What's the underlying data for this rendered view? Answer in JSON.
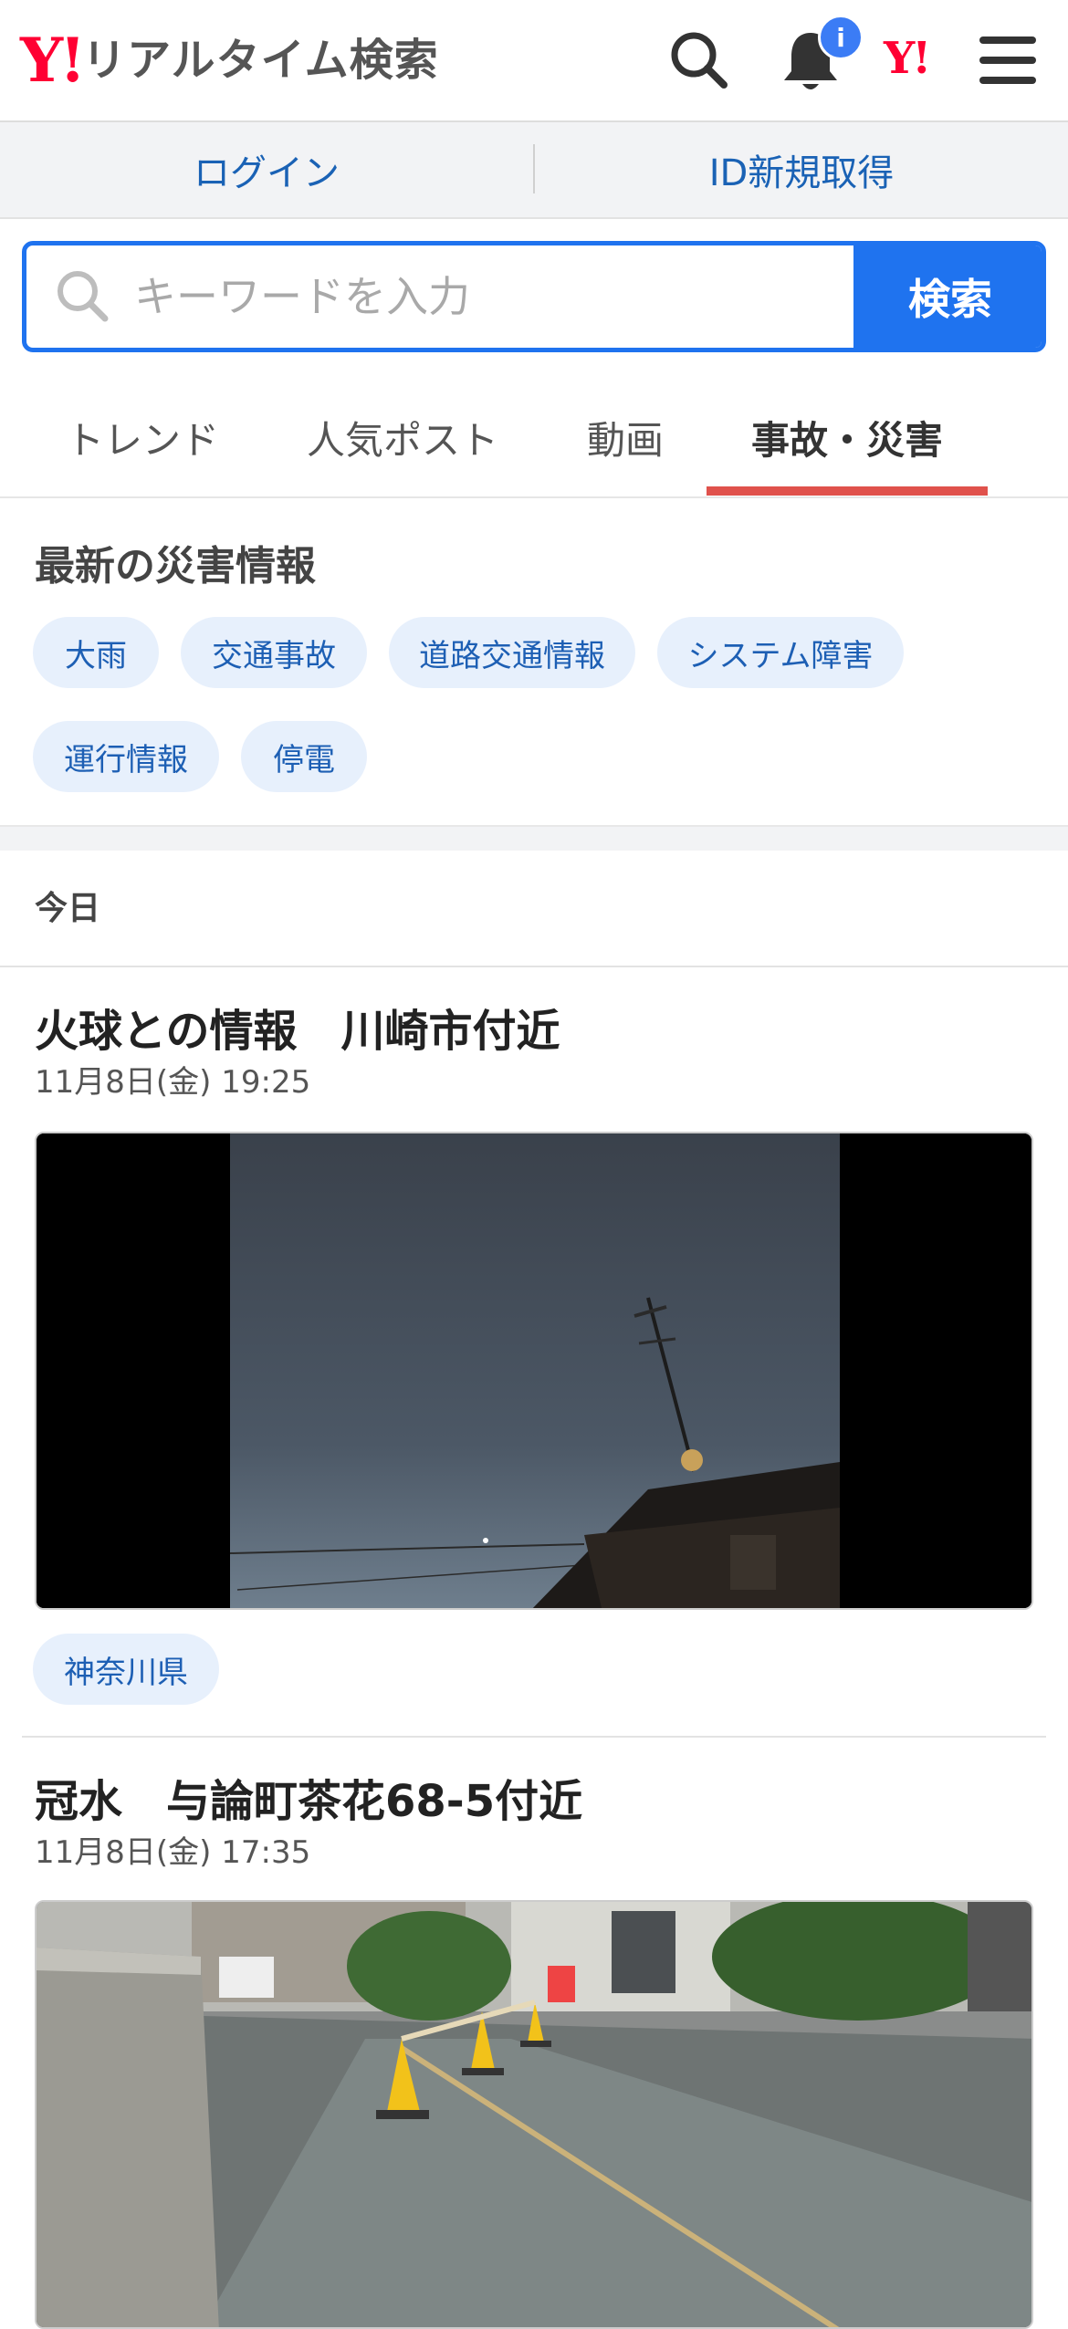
{
  "app": {
    "logo_mark": "Y!",
    "logo_text": "リアルタイム検索",
    "notification_badge": "i",
    "yahoo_mini": "Y!"
  },
  "header_icons": [
    "search-icon",
    "bell-icon",
    "yahoo-icon",
    "menu-icon"
  ],
  "login": {
    "login_label": "ログイン",
    "signup_label": "ID新規取得"
  },
  "search": {
    "placeholder": "キーワードを入力",
    "button_label": "検索",
    "value": ""
  },
  "tabs": [
    {
      "label": "トレンド",
      "active": false
    },
    {
      "label": "人気ポスト",
      "active": false
    },
    {
      "label": "動画",
      "active": false
    },
    {
      "label": "事故・災害",
      "active": true
    }
  ],
  "disaster": {
    "title": "最新の災害情報",
    "chips": [
      "大雨",
      "交通事故",
      "道路交通情報",
      "システム障害",
      "運行情報",
      "停電"
    ]
  },
  "feed": {
    "day_label": "今日",
    "posts": [
      {
        "title": "火球との情報　川崎市付近",
        "time": "11月8日(金) 19:25",
        "tag": "神奈川県"
      },
      {
        "title": "冠水　与論町茶花68-5付近",
        "time": "11月8日(金) 17:35"
      }
    ]
  },
  "colors": {
    "accent_blue": "#1f73ef",
    "link_blue": "#1a62b5",
    "yahoo_red": "#ff0033",
    "active_tab_underline": "#e0524c",
    "chip_bg": "#e7f0fc"
  }
}
